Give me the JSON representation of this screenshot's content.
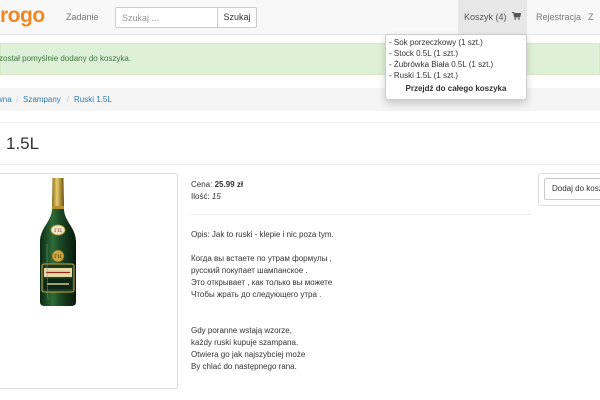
{
  "navbar": {
    "brand": "rogo",
    "task_link": "Zadanie",
    "search_placeholder": "Szukaj ...",
    "search_button": "Szukaj",
    "cart_label": "Koszyk (4)",
    "cart_icon": "shopping-cart-icon",
    "register_link": "Rejestracja",
    "login_link": "Z"
  },
  "cart_dropdown": {
    "items": [
      "- Sok porzeczkowy (1 szt.)",
      "- Stock 0.5L (1 szt.)",
      "- Żubrówka Biała 0.5L (1 szt.)",
      "- Ruski 1.5L (1 szt.)"
    ],
    "footer": "Przejdź do całego koszyka"
  },
  "alert": {
    "message": "został pomyślnie dodany do koszyka."
  },
  "breadcrumb": {
    "items": [
      "wna",
      "Szampany",
      "Ruski 1.5L"
    ],
    "separator": "/"
  },
  "product": {
    "title": " 1.5L",
    "price_label": "Cena:",
    "price_value": "25.99 zł",
    "qty_label": "Ilość:",
    "qty_value": "15",
    "description_lines": [
      "Opis: Jak to ruski - klepie i nic poza tym.",
      "",
      "Когда вы встаете по утрам формулы ,",
      "русский покупает шампанское .",
      "Это открывает , как только вы можете",
      "Чтобы жрать до следующего утра .",
      "",
      "",
      "Gdy poranne wstają wzorze,",
      "każdy ruski kupuje szampana.",
      "Otwiera go jak najszybciej może",
      "By chlać do następnego rana."
    ],
    "add_button": "Dodaj do koszyka"
  },
  "colors": {
    "brand": "#f0871f",
    "alert_bg": "#dff0d8",
    "alert_text": "#3c763d",
    "link": "#337ab7"
  }
}
